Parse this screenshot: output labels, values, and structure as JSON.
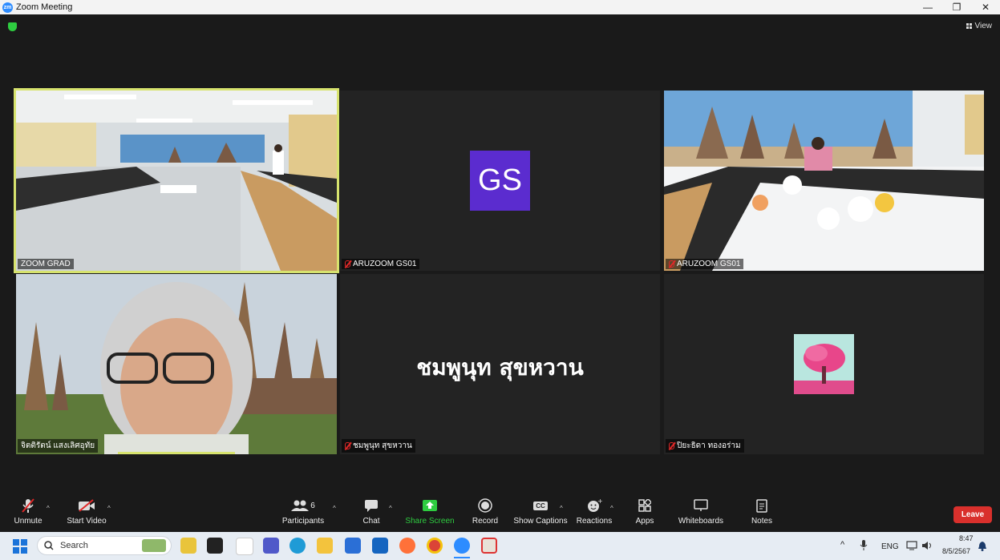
{
  "window": {
    "title": "Zoom Meeting",
    "minimize": "—",
    "restore": "❐",
    "close": "✕"
  },
  "view_label": "View",
  "tiles": [
    {
      "name": "ZOOM GRAD"
    },
    {
      "name": "ARUZOOM GS01",
      "initials": "GS"
    },
    {
      "name": "ARUZOOM GS01"
    },
    {
      "name": "จิตติรัตน์ แสงเลิศอุทัย"
    },
    {
      "name": "ชมพูนุท  สุขหวาน",
      "display": "ชมพูนุท  สุขหวาน"
    },
    {
      "name": "ปิยะธิดา ทองอร่าม"
    }
  ],
  "toolbar": {
    "unmute": "Unmute",
    "start_video": "Start Video",
    "participants": "Participants",
    "participants_count": "6",
    "chat": "Chat",
    "share_screen": "Share Screen",
    "record": "Record",
    "show_captions": "Show Captions",
    "captions_badge": "CC",
    "reactions": "Reactions",
    "apps": "Apps",
    "whiteboards": "Whiteboards",
    "notes": "Notes",
    "leave": "Leave"
  },
  "taskbar": {
    "search_placeholder": "Search",
    "lang": "ENG",
    "time": "8:47",
    "date": "8/5/2567"
  },
  "colors": {
    "active_speaker": "#d7e36e",
    "share_green": "#2ecc40",
    "leave_red": "#d9302c",
    "gs_avatar": "#5b2ccf"
  }
}
